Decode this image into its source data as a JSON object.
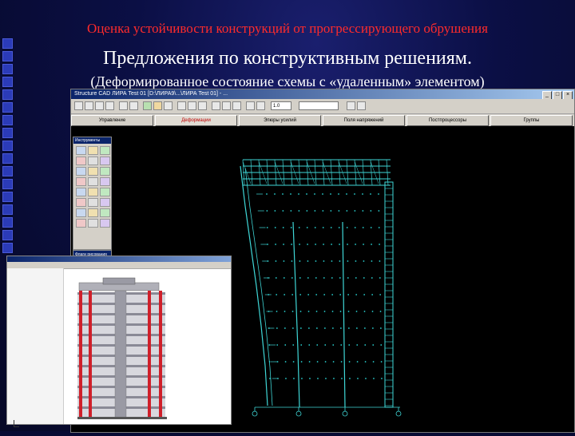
{
  "slide": {
    "title_top": "Оценка устойчивости конструкций от прогрессирующего обрушения",
    "title_main": "Предложения по конструктивным решениям.",
    "title_sub": "(Деформированное состояние схемы с «удаленным» элементом)"
  },
  "app": {
    "window_title": "Structure CAD ЛИРА Test 01 [D:\\ЛИРА9\\...\\ЛИРА Test 01] - ...",
    "tabs": [
      {
        "label": "Управление"
      },
      {
        "label": "Деформации"
      },
      {
        "label": "Эпюры усилий"
      },
      {
        "label": "Поля напряжений"
      },
      {
        "label": "Постпроцессоры"
      },
      {
        "label": "Группы"
      }
    ],
    "active_tab": 1,
    "zoom_value": "1.0",
    "palette_title": "Инструменты",
    "palette_b_title": "Флаги рисования"
  },
  "colors": {
    "slide_bg": "#070a33",
    "title_top": "#ff2b2b",
    "title_text": "#ffffff",
    "frame": "#3fd7d7",
    "nodes": "#2ad2d2",
    "canvas": "#000000",
    "column_red": "#d01f2a"
  },
  "icons": [
    "window-minimize-icon",
    "window-maximize-icon",
    "window-close-icon",
    "toolbar-tool-icons",
    "palette-tool-icons"
  ]
}
